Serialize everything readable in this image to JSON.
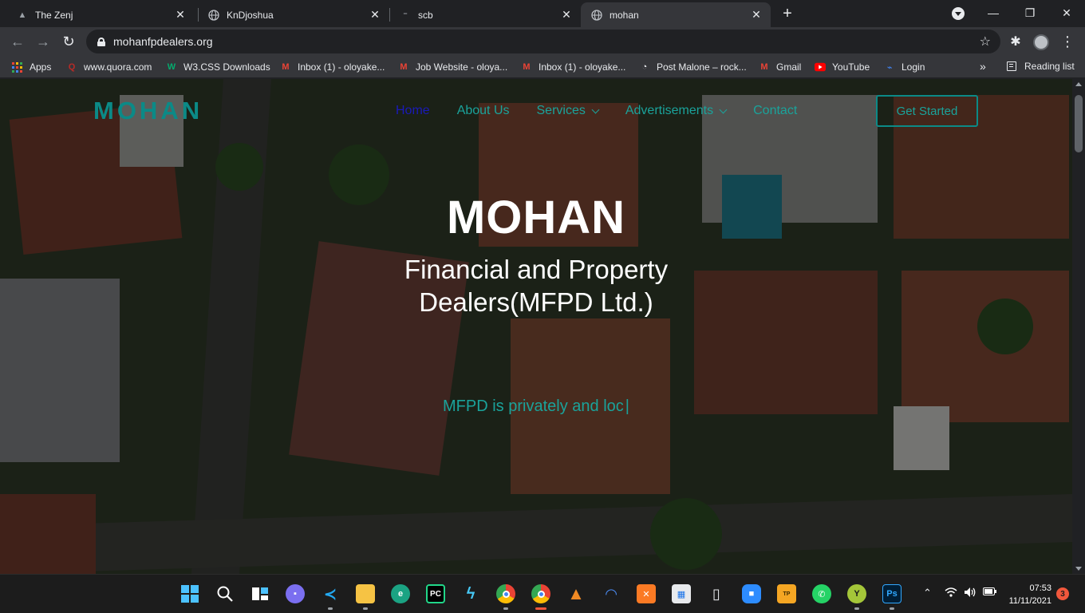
{
  "browser": {
    "tabs": [
      {
        "title": "The Zenj",
        "icon": "zenj-favicon"
      },
      {
        "title": "KnDjoshua",
        "icon": "globe-icon"
      },
      {
        "title": "scb",
        "icon": "scb-favicon"
      },
      {
        "title": "mohan",
        "icon": "globe-icon",
        "active": true
      }
    ],
    "new_tab_label": "+",
    "address": "mohanfpdealers.org",
    "bookmarks": [
      {
        "label": "Apps",
        "icon": "apps-grid-icon"
      },
      {
        "label": "www.quora.com",
        "icon": "quora-icon"
      },
      {
        "label": "W3.CSS Downloads",
        "icon": "w3-icon"
      },
      {
        "label": "Inbox (1) - oloyake...",
        "icon": "gmail-icon"
      },
      {
        "label": "Job Website - oloya...",
        "icon": "gmail-icon"
      },
      {
        "label": "Inbox (1) - oloyake...",
        "icon": "gmail-icon"
      },
      {
        "label": "Post Malone – rock...",
        "icon": "music-icon"
      },
      {
        "label": "Gmail",
        "icon": "gmail-icon"
      },
      {
        "label": "YouTube",
        "icon": "youtube-icon"
      },
      {
        "label": "Login",
        "icon": "login-icon"
      }
    ],
    "bookmarks_more": "»",
    "reading_list": "Reading list"
  },
  "site": {
    "logo": "MOHAN",
    "nav": [
      {
        "label": "Home",
        "active": true,
        "dropdown": false
      },
      {
        "label": "About Us",
        "active": false,
        "dropdown": false
      },
      {
        "label": "Services",
        "active": false,
        "dropdown": true
      },
      {
        "label": "Advertisements",
        "active": false,
        "dropdown": true
      },
      {
        "label": "Contact",
        "active": false,
        "dropdown": false
      }
    ],
    "cta": "Get Started",
    "hero": {
      "title": "MOHAN",
      "subtitle": "Financial and Property Dealers(MFPD Ltd.)",
      "typed_text": "MFPD is privately and loc",
      "caret": "|"
    },
    "colors": {
      "accent": "#0b8a87",
      "accent_light": "#1aa39b",
      "active_nav": "#1a1ab8"
    }
  },
  "taskbar": {
    "apps": [
      "windows-start-icon",
      "search-icon",
      "task-view-icon",
      "chat-icon",
      "vscode-icon",
      "file-explorer-icon",
      "edge-icon",
      "pycharm-icon",
      "flutter-icon",
      "chrome-icon",
      "chrome-profile-icon",
      "vlc-icon",
      "wifi-tool-icon",
      "xampp-icon",
      "store-icon",
      "phone-link-icon",
      "zoom-icon",
      "typing-practice-icon",
      "whatsapp-icon",
      "android-icon",
      "photoshop-icon"
    ],
    "time": "07:53",
    "date": "11/11/2021",
    "notifications": "3"
  }
}
